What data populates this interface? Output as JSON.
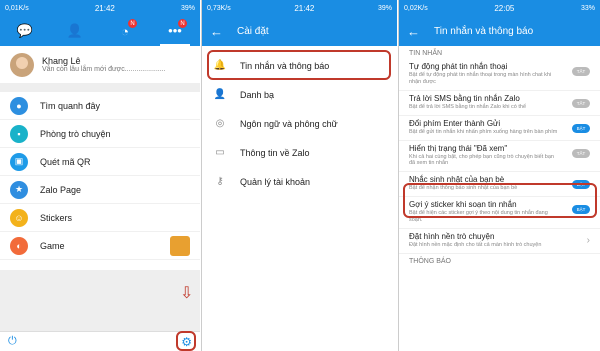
{
  "panel1": {
    "status": {
      "left": "0,01K/s",
      "time": "21:42",
      "right": "39%"
    },
    "tab_badges": [
      "N",
      "N"
    ],
    "profile": {
      "name": "Khang Lê",
      "status": "Vẫn còn lâu lắm mới được....................."
    },
    "menu": [
      {
        "label": "Tìm quanh đây",
        "icon": "location-icon",
        "color": "#2d8fe0",
        "glyph": "●"
      },
      {
        "label": "Phòng trò chuyện",
        "icon": "chat-room-icon",
        "color": "#19b2c9",
        "glyph": "▪"
      },
      {
        "label": "Quét mã QR",
        "icon": "qr-icon",
        "color": "#1e9be8",
        "glyph": "▣"
      },
      {
        "label": "Zalo Page",
        "icon": "star-icon",
        "color": "#2f8ee0",
        "glyph": "★"
      },
      {
        "label": "Stickers",
        "icon": "sticker-icon",
        "color": "#f3b21b",
        "glyph": "☺"
      },
      {
        "label": "Game",
        "icon": "game-icon",
        "color": "#f26b3a",
        "glyph": "◐"
      }
    ]
  },
  "panel2": {
    "status": {
      "left": "0,73K/s",
      "time": "21:42",
      "right": "39%"
    },
    "title": "Cài đặt",
    "items": [
      {
        "label": "Tin nhắn và thông báo",
        "icon": "bell-icon",
        "glyph": "🔔"
      },
      {
        "label": "Danh bạ",
        "icon": "contacts-icon",
        "glyph": "👤"
      },
      {
        "label": "Ngôn ngữ và phông chữ",
        "icon": "globe-icon",
        "glyph": "◎"
      },
      {
        "label": "Thông tin về Zalo",
        "icon": "zalo-icon",
        "glyph": "▭"
      },
      {
        "label": "Quản lý tài khoản",
        "icon": "key-icon",
        "glyph": "⚷"
      }
    ]
  },
  "panel3": {
    "status": {
      "left": "0,02K/s",
      "time": "22:05",
      "right": "33%"
    },
    "title": "Tin nhắn và thông báo",
    "section1": "TIN NHẮN",
    "options": [
      {
        "title": "Tự động phát tin nhắn thoại",
        "desc": "Bật để tự động phát tin nhắn thoại trong màn hình chat khi nhận được",
        "state": "off",
        "toggle": "TẮT"
      },
      {
        "title": "Trả lời SMS bằng tin nhắn Zalo",
        "desc": "Bật để trả lời SMS bằng tin nhắn Zalo khi có thể",
        "state": "off",
        "toggle": "TẮT"
      },
      {
        "title": "Đổi phím Enter thành Gửi",
        "desc": "Bật để gửi tin nhắn khi nhấn phím xuống hàng trên bàn phím",
        "state": "on",
        "toggle": "BẬT"
      },
      {
        "title": "Hiển thị trạng thái \"Đã xem\"",
        "desc": "Khi cả hai cùng bật, cho phép bạn cũng trò chuyện biết bạn đã xem tin nhắn",
        "state": "off",
        "toggle": "TẮT"
      },
      {
        "title": "Nhắc sinh nhật của bạn bè",
        "desc": "Bật để nhận thông báo sinh nhật của bạn bè",
        "state": "on",
        "toggle": "BẬT"
      },
      {
        "title": "Gợi ý sticker khi soạn tin nhắn",
        "desc": "Bật để hiện các sticker gợi ý theo nội dung tin nhắn đang soạn.",
        "state": "on",
        "toggle": "BẬT"
      },
      {
        "title": "Đặt hình nền trò chuyện",
        "desc": "Đặt hình nền mặc định cho tất cả màn hình trò chuyện",
        "state": "link",
        "toggle": ""
      }
    ],
    "section2": "THÔNG BÁO"
  }
}
